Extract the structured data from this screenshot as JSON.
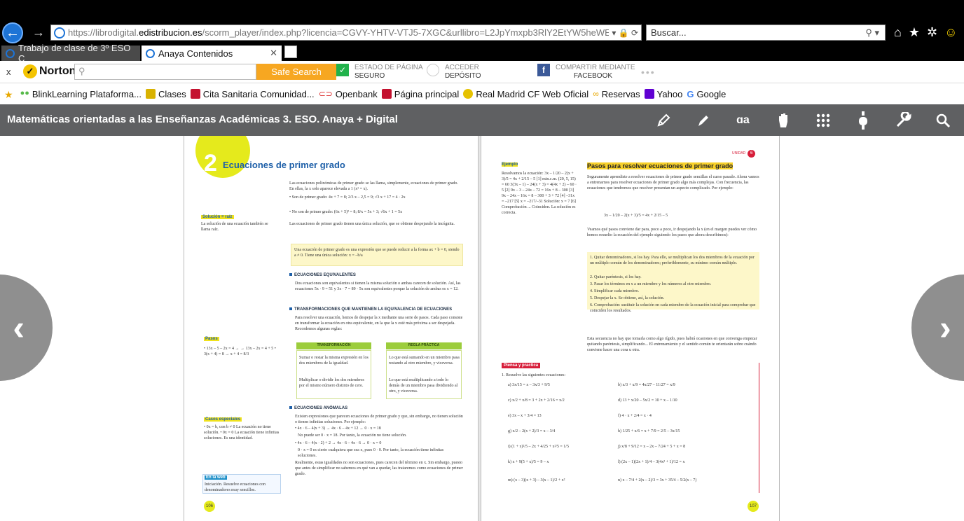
{
  "browser": {
    "url_prefix": "https://librodigital.",
    "url_domain": "edistribucion.es",
    "url_rest": "/scorm_player/index.php?licencia=CGVY-YHTV-VTJ5-7XGC&urllibro=L2JpYmxpb3RlY2EtYW5heWEvbGlicm8v",
    "url_tools": "▾ 🔒 ⟳",
    "search_placeholder": "Buscar..."
  },
  "tabs": [
    {
      "label": "Trabajo de clase de 3º ESO C"
    },
    {
      "label": "Anaya Contenidos"
    }
  ],
  "norton": {
    "close": "x",
    "logo": "Norton",
    "safe_search": "Safe Search",
    "status1_title": "ESTADO DE PÁGINA",
    "status1_value": "SEGURO",
    "status2_title": "ACCEDER",
    "status2_value": "DEPÓSITO",
    "status3_title": "COMPARTIR MEDIANTE",
    "status3_value": "FACEBOOK",
    "more": "•••"
  },
  "favorites": [
    {
      "label": "BlinkLearning  Plataforma..."
    },
    {
      "label": "Clases"
    },
    {
      "label": "Cita Sanitaria  Comunidad..."
    },
    {
      "label": "Openbank"
    },
    {
      "label": "Página principal"
    },
    {
      "label": "Real Madrid CF  Web Oficial"
    },
    {
      "label": "Reservas"
    },
    {
      "label": "Yahoo"
    },
    {
      "label": "Google"
    }
  ],
  "app": {
    "title": "Matemáticas orientadas a las Enseñanzas Académicas 3. ESO. Anaya + Digital",
    "tools": [
      "pencil-icon",
      "marker-icon",
      "text-size-icon",
      "hand-icon",
      "grid-icon",
      "pointer-icon",
      "wrench-icon",
      "search-icon"
    ]
  },
  "page_left": {
    "number_big": "2",
    "chapter_title": "Ecuaciones de primer grado",
    "intro": "Las ecuaciones polinómicas de primer grado se las llama, simplemente, ecuaciones de primer grado. En ellas, la x solo aparece elevada a 1 (x¹ = x).",
    "bullet1": "• Son de primer grado:  4x + 7 = 8;   2/3 x – 2,5 = 9;   √3 x + 17 = 4 · 2x",
    "bullet2": "• No son de primer grado:  (6x + 5)² = 8;   8/x = 5x + 3;   √6x + 1 = 5x",
    "intro2": "Las ecuaciones de primer grado tienen una única solución, que se obtiene despejando la incógnita.",
    "side_solucion_title": "Solución = raíz",
    "side_solucion_text": "La solución de una ecuación también se llama raíz.",
    "def_box": "Una ecuación de primer grado es una expresión que se puede reducir a la forma ax + b = 0, siendo a ≠ 0. Tiene una única solución: x = –b/a",
    "sec1_title": "ECUACIONES EQUIVALENTES",
    "sec1_text": "Dos ecuaciones son equivalentes si tienen la misma solución o ambas carecen de solución. Así, las ecuaciones 5x · 9 = 51 y 3x · 7 = 89 · 5x son equivalentes porque la solución de ambas es x = 12.",
    "sec2_title": "TRANSFORMACIONES QUE MANTIENEN LA EQUIVALENCIA DE ECUACIONES",
    "sec2_text": "Para resolver una ecuación, hemos de despejar la x mediante una serie de pasos. Cada paso consiste en transformar la ecuación en otra equivalente, en la que la x esté más próxima a ser despejada. Recordemos algunas reglas:",
    "side_pasos_title": "Pasos",
    "side_pasos_text": "• 13x – 5 – 2x = 4 →  → 13x – 2x = 4 + 5  • 3(x + 4) = 8 → x + 4 = 8/3",
    "table_head1": "TRANSFORMACIÓN",
    "table_head2": "REGLA PRÁCTICA",
    "table_r1c1": "Sumar o restar la misma expresión en los dos miembros de la igualdad.",
    "table_r1c2": "Lo que está sumando en un miembro pasa restando al otro miembro, y viceversa.",
    "table_r2c1": "Multiplicar o dividir los dos miembros por el mismo número distinto de cero.",
    "table_r2c2": "Lo que está multiplicando a todo lo demás de un miembro pasa dividiendo al otro, y viceversa.",
    "sec3_title": "ECUACIONES ANÓMALAS",
    "sec3_text": "Existen expresiones que parecen ecuaciones de primer grado y que, sin embargo, no tienen solución o tienen infinitas soluciones. Por ejemplo:",
    "sec3_b1": "• 4x · 6 – 4(x + 3) → 4x · 6 – 4x + 12 → 0 · x = 18",
    "sec3_b1b": "No puede ser 0 · x = 18. Por tanto, la ecuación no tiene solución.",
    "sec3_b2": "• 4x · 6 – 4(x · 2) + 2 → 4x · 6 – 4x · 6 → 0 · x = 0",
    "sec3_b2b": "0 · x = 0 es cierto cualquiera que sea x, pues 0 · 0. Por tanto, la ecuación tiene infinitas soluciones.",
    "sec3_end": "Realmente, estas igualdades no son ecuaciones, pues carecen del término en x. Sin embargo, puesto que antes de simplificar no sabemos en qué van a quedar, las trataremos como ecuaciones de primer grado.",
    "side_casos_title": "Casos especiales",
    "side_casos_text": "• 0x = b, con b ≠ 0  La ecuación no tiene solución.  • 0x = 0  La ecuación tiene infinitas soluciones. Es una identidad.",
    "side_ini_title": "En la web",
    "side_ini_text": "Iniciación. Resuelve ecuaciones con denominadores muy sencillos.",
    "page_num": "106"
  },
  "page_right": {
    "unidad": "UNIDAD",
    "unidad_num": "6",
    "ejemplo_label": "Ejemplo",
    "ejemplo_text": "Resolvamos la ecuación:  3x – 1/20 – 2(x + 3)/5 = 4x + 2/15 – 5   [1] min.c.m. (20, 5, 15) = 60   3(3x – 1) – 24(x + 3) = 4(4x + 2) – 60 · 5   [2]   9x – 3 – 24x – 72 = 16x + 8 – 300   [3]   9x – 24x – 16x = 8 – 300 + 3 + 72   [4]   –31x = –217   [5]   x = –217/–31   Solución: x = 7   [6]   Comprobación ... Coinciden. La solución es correcta.",
    "pasos_title": "Pasos para resolver ecuaciones de primer grado",
    "pasos_intro": "Seguramente aprendiste a resolver ecuaciones de primer grado sencillas el curso pasado. Ahora vamos a entrenarnos para resolver ecuaciones de primer grado algo más complejas. Con frecuencia, las ecuaciones que tendremos que resolver presentan un aspecto complicado. Por ejemplo:",
    "pasos_eq": "3x – 1/20 – 2(x + 3)/5 = 4x + 2/15 – 5",
    "pasos_text2": "Veamos qué pasos conviene dar para, poco a poco, ir despejando la x (en el margen puedes ver cómo hemos resuelto la ecuación del ejemplo siguiendo los pasos que ahora describimos):",
    "steps": [
      "1. Quitar denominadores, si los hay. Para ello, se multiplican los dos miembros de la ecuación por un múltiplo común de los denominadores; preferiblemente, su mínimo común múltiplo.",
      "2. Quitar paréntesis, si los hay.",
      "3. Pasar los términos en x a un miembro y los números al otro miembro.",
      "4. Simplificar cada miembro.",
      "5. Despejar la x. Se obtiene, así, la solución.",
      "6. Comprobación: sustituir la solución en cada miembro de la ecuación inicial para comprobar que coinciden los resultados."
    ],
    "pasos_end": "Esta secuencia no hay que tomarla como algo rígido, pues habrá ocasiones en que convenga empezar quitando paréntesis, simplificando... El entrenamiento y el sentido común te orientarán sobre cuándo conviene hacer una cosa u otra.",
    "practica_label": "Piensa y practica",
    "practica_intro": "1. Resuelve las siguientes ecuaciones:",
    "ex_left": [
      "a) 3x/15 = x – 3x/3 + 9/5",
      "c) x/2 + x/8 = 3 + 2x + 2/16 = x/2",
      "e) 3x – x + 3/4 = 13",
      "g) x/2 – 2(x + 2)/3 = x – 3/4",
      "i) (1 + x)²/5 – 2x + 4/25 + x²/5 = 1/5",
      "k) x + 9(5 + x)/5 = 9 – x",
      "m) (x – 3)(x + 3) – 3(x – 1)/2 + x²"
    ],
    "ex_right": [
      "b) x/3 + x/9 = 4x/27 – 11/27 = x/9",
      "d) 13 + x/20 – 5x/2 = 10 + x – 1/10",
      "f) 4 · x + 2/4 = x · 4",
      "h) 1/25 + x/6 = x + 7/9 = 2/5 – 3x/15",
      "j) x/8 + 9/12 = x – 2x – 7/24 + 5 + x = 8",
      "l) (2x – 1)(2x + 1)/4 – 3(4x² + 1)/12 = x",
      "n) x – 7/4 + 2(x – 2)/3 = 3x + 35/4 – 5/2(x – 7)"
    ],
    "page_num": "107"
  }
}
